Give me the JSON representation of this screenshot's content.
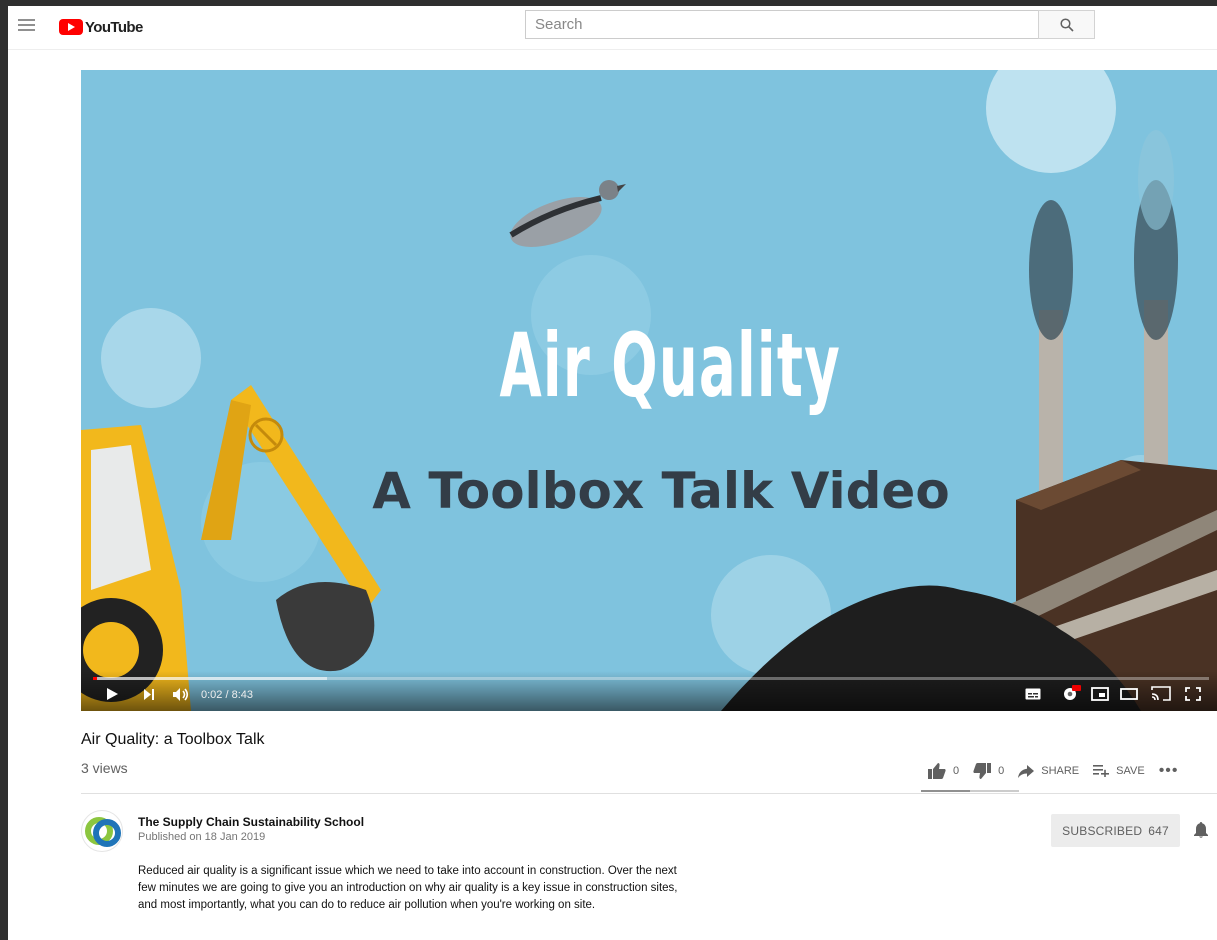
{
  "masthead": {
    "logo_text": "YouTube",
    "search_placeholder": "Search"
  },
  "player": {
    "overlay_title": "Air Quality",
    "overlay_subtitle": "A Toolbox Talk Video",
    "current_time": "0:02",
    "duration": "8:43",
    "time_display": "0:02 / 8:43",
    "progress_fraction": 0.004,
    "buffered_fraction": 0.21,
    "hd_badge": "HD"
  },
  "video": {
    "title": "Air Quality: a Toolbox Talk",
    "views": "3 views"
  },
  "actions": {
    "likes": "0",
    "dislikes": "0",
    "share_label": "SHARE",
    "save_label": "SAVE",
    "more_label": "•••"
  },
  "channel": {
    "name": "The Supply Chain Sustainability School",
    "published": "Published on 18 Jan 2019",
    "subscribe_label": "SUBSCRIBED",
    "subscriber_count": "647"
  },
  "description": "Reduced air quality is a significant issue which we need to take into account in construction.  Over the next few minutes we are going to give you an introduction on why air quality is a key issue in construction sites, and most importantly, what you can do to reduce air pollution when you're working on site.",
  "colors": {
    "brand_red": "#ff0000",
    "sky": "#7fc3de",
    "digger_yellow": "#f2b81c"
  }
}
